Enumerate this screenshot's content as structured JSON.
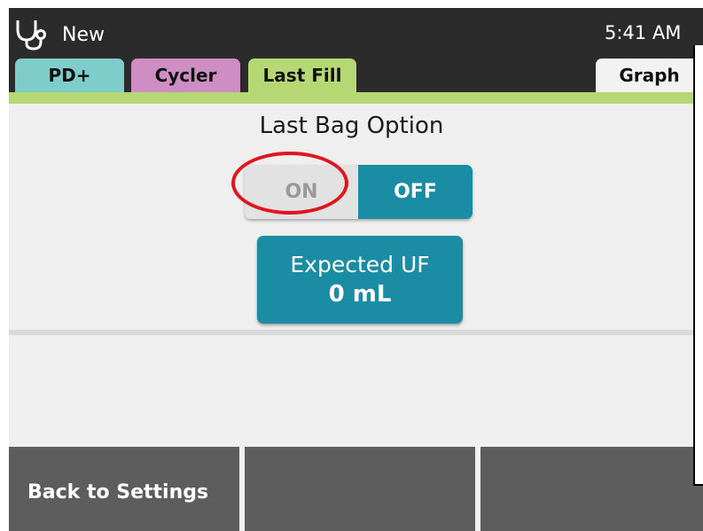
{
  "header": {
    "icon": "stethoscope-icon",
    "mode_label": "New",
    "time": "5:41 AM"
  },
  "tabs": [
    {
      "label": "PD+",
      "color": "#7ecdcb",
      "active": false
    },
    {
      "label": "Cycler",
      "color": "#cf8ec3",
      "active": false
    },
    {
      "label": "Last Fill",
      "color": "#b5d874",
      "active": true
    },
    {
      "label": "Graph",
      "color": "#f2f2f2",
      "active": false
    }
  ],
  "last_bag": {
    "title": "Last Bag Option",
    "on_label": "ON",
    "off_label": "OFF",
    "selected": "OFF"
  },
  "expected_uf": {
    "label": "Expected UF",
    "value": "0 mL"
  },
  "footer": {
    "back_label": "Back to Settings",
    "middle_label": "",
    "right_label": ""
  },
  "colors": {
    "accent_teal": "#1a8ca3",
    "highlight_red": "#e0161e",
    "header_bg": "#2b2b2b",
    "footer_bg": "#5d5d5d"
  }
}
